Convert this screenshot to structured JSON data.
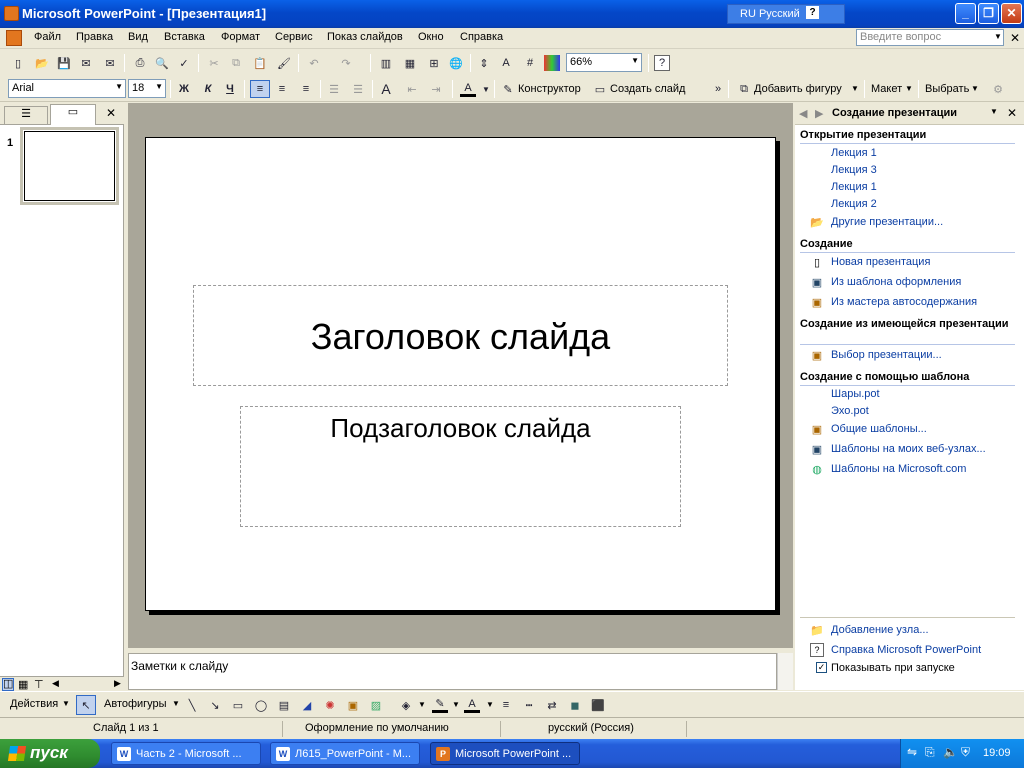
{
  "window": {
    "title": "Microsoft PowerPoint - [Презентация1]",
    "language": "RU Русский",
    "minimize": "_",
    "restore": "❐",
    "close": "✕"
  },
  "menu": {
    "items": [
      "Файл",
      "Правка",
      "Вид",
      "Вставка",
      "Формат",
      "Сервис",
      "Показ слайдов",
      "Окно",
      "Справка"
    ],
    "help_placeholder": "Введите вопрос"
  },
  "toolbar": {
    "zoom": "66%",
    "font": "Arial",
    "font_size": "18",
    "bold": "Ж",
    "italic": "К",
    "underline": "Ч",
    "designer": "Конструктор",
    "create_slide": "Создать слайд",
    "add_shape": "Добавить фигуру",
    "layout": "Макет",
    "select": "Выбрать"
  },
  "slides": {
    "thumbnail_number": "1"
  },
  "slide": {
    "title": "Заголовок слайда",
    "subtitle": "Подзаголовок слайда"
  },
  "notes": {
    "placeholder": "Заметки к слайду"
  },
  "taskpane": {
    "title": "Создание презентации",
    "open_section": "Открытие презентации",
    "recent": [
      "Лекция 1",
      "Лекция 3",
      "Лекция 1",
      "Лекция 2"
    ],
    "more": "Другие презентации...",
    "create_section": "Создание",
    "create_items": [
      "Новая презентация",
      "Из шаблона оформления",
      "Из мастера автосодержания"
    ],
    "existing_section": "Создание из имеющейся презентации",
    "existing_item": "Выбор презентации...",
    "template_section": "Создание с помощью шаблона",
    "templates": [
      "Шары.pot",
      "Эхо.pot"
    ],
    "template_links": [
      "Общие шаблоны...",
      "Шаблоны на моих веб-узлах...",
      "Шаблоны на Microsoft.com"
    ],
    "footer": [
      "Добавление узла...",
      "Справка Microsoft PowerPoint"
    ],
    "show_at_startup": "Показывать при запуске"
  },
  "drawbar": {
    "actions": "Действия",
    "autoshapes": "Автофигуры"
  },
  "status": {
    "slide": "Слайд 1 из 1",
    "design": "Оформление по умолчанию",
    "language": "русский (Россия)"
  },
  "taskbar": {
    "start": "пуск",
    "tasks": [
      "Часть 2 - Microsoft ...",
      "Л615_PowerPoint - M...",
      "Microsoft PowerPoint ..."
    ],
    "clock": "19:09"
  }
}
